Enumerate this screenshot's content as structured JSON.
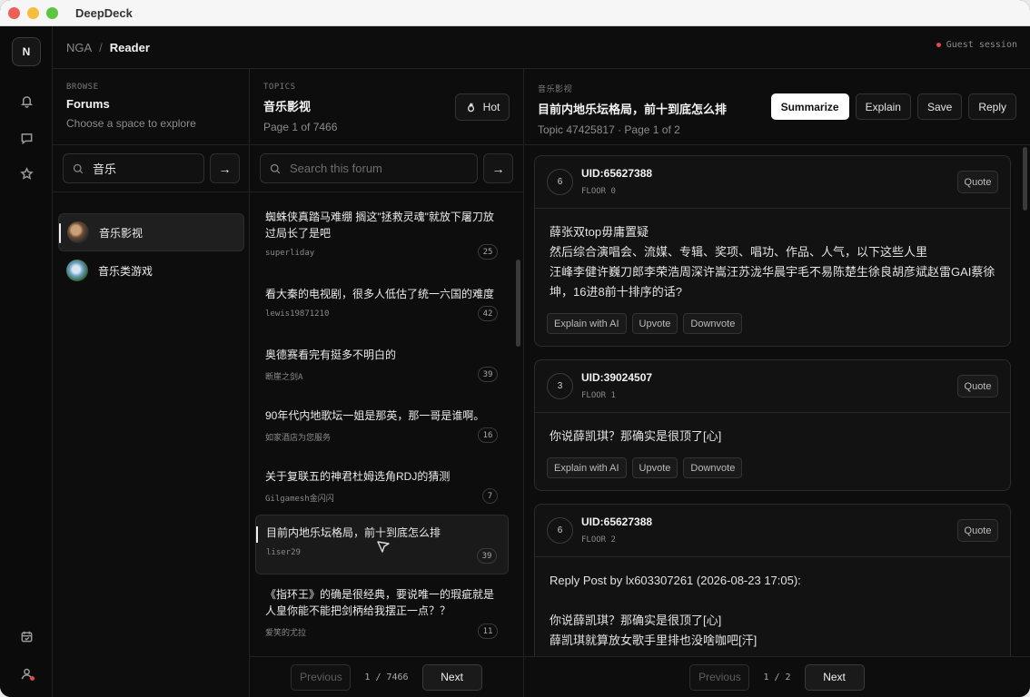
{
  "app": {
    "title": "DeepDeck"
  },
  "rail": {
    "logo": "N",
    "icons": [
      "bell-icon",
      "chat-icon",
      "star-icon",
      "calendar-icon",
      "user-icon"
    ]
  },
  "breadcrumb": {
    "root": "NGA",
    "sep": "/",
    "current": "Reader"
  },
  "session": {
    "label": "Guest session",
    "dot_color": "#e5484d"
  },
  "forums_panel": {
    "eyebrow": "BROWSE",
    "title": "Forums",
    "subtitle": "Choose a space to explore",
    "search_value": "音乐",
    "items": [
      {
        "label": "音乐影视",
        "active": true
      },
      {
        "label": "音乐类游戏",
        "active": false
      }
    ]
  },
  "topics_panel": {
    "eyebrow": "TOPICS",
    "title": "音乐影视",
    "subtitle": "Page 1 of 7466",
    "hot_label": "Hot",
    "search_placeholder": "Search this forum",
    "items": [
      {
        "title": "蜘蛛侠真踏马难绷 搁这\"拯救灵魂\"就放下屠刀放过局长了是吧",
        "author": "superliday",
        "count": "25"
      },
      {
        "title": "看大秦的电视剧，很多人低估了统一六国的难度",
        "author": "lewis19871210",
        "count": "42"
      },
      {
        "title": "奥德赛看完有挺多不明白的",
        "author": "断崖之剑A",
        "count": "39"
      },
      {
        "title": "90年代内地歌坛一姐是那英，那一哥是谁啊。",
        "author": "如家酒店为您服务",
        "count": "16"
      },
      {
        "title": "关于复联五的神君杜姆选角RDJ的猜测",
        "author": "Gilgamesh金闪闪",
        "count": "7"
      },
      {
        "title": "目前内地乐坛格局，前十到底怎么排",
        "author": "liser29",
        "count": "39",
        "active": true
      },
      {
        "title": "《指环王》的确是很经典，要说唯一的瑕疵就是人皇你能不能把剑柄给我摆正一点？？",
        "author": "爱笑的尤拉",
        "count": "11"
      }
    ],
    "pager": {
      "prev": "Previous",
      "info": "1 / 7466",
      "next": "Next"
    }
  },
  "thread_panel": {
    "eyebrow": "音乐影视",
    "title": "目前内地乐坛格局，前十到底怎么排",
    "subtitle": "Topic 47425817 · Page 1 of 2",
    "actions": {
      "summarize": "Summarize",
      "explain": "Explain",
      "save": "Save",
      "reply": "Reply"
    },
    "posts": [
      {
        "badge": "6",
        "uid": "UID:65627388",
        "floor": "FLOOR 0",
        "quote": "Quote",
        "lines": [
          "薛张双top毋庸置疑",
          "然后综合演唱会、流媒、专辑、奖项、唱功、作品、人气，以下这些人里",
          "汪峰李健许巍刀郎李荣浩周深许嵩汪苏泷华晨宇毛不易陈楚生徐良胡彦斌赵雷GAI蔡徐坤，16进8前十排序的话?"
        ]
      },
      {
        "badge": "3",
        "uid": "UID:39024507",
        "floor": "FLOOR 1",
        "quote": "Quote",
        "lines": [
          "你说薛凯琪？那确实是很顶了[心]"
        ]
      },
      {
        "badge": "6",
        "uid": "UID:65627388",
        "floor": "FLOOR 2",
        "quote": "Quote",
        "lines": [
          "Reply Post by lx603307261 (2026-08-23 17:05):",
          "",
          "你说薛凯琪？那确实是很顶了[心]",
          "薛凯琪就算放女歌手里排也没啥咖吧[汗]"
        ]
      }
    ],
    "post_actions": {
      "explain": "Explain with AI",
      "upvote": "Upvote",
      "downvote": "Downvote"
    },
    "pager": {
      "prev": "Previous",
      "info": "1 / 2",
      "next": "Next"
    }
  }
}
